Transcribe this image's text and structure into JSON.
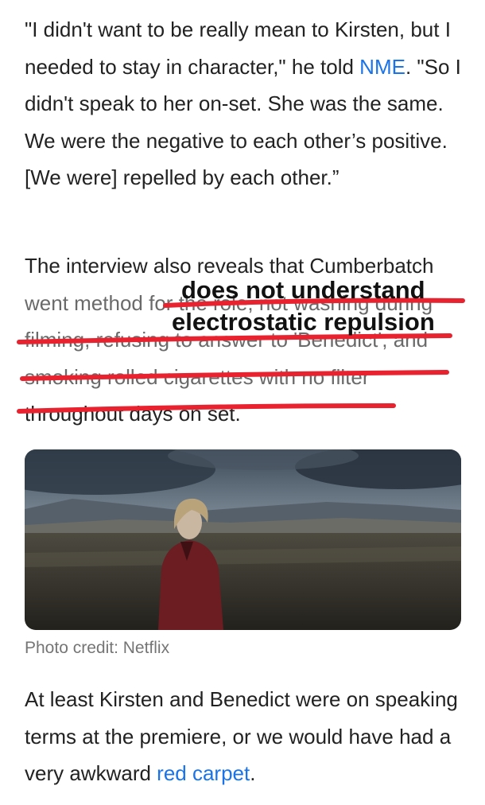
{
  "article": {
    "quote_para": {
      "before_link": "\"I didn't want to be really mean to Kirsten, but I needed to stay in character,\" he told ",
      "link": "NME",
      "after_link": ". \"So I didn't speak to her on-set. She was the same. We were the negative to each other’s positive. [We were] repelled by each other.”"
    },
    "interview_para": {
      "start": "The interview also reveals that Cumberbatch ",
      "struck": "went method for the role, not washing during filming, refusing to answer to 'Benedict', and smoking rolled cigarettes with no filter",
      "end": " throughout days on set."
    },
    "photo_credit": "Photo credit: Netflix",
    "closing_para": {
      "before_link": "At least Kirsten and Benedict were on speaking terms at the premiere, or we would have had a very awkward ",
      "link": "red carpet",
      "after_link": "."
    }
  },
  "annotation": {
    "line1": "does not understand",
    "line2": "electrostatic repulsion"
  },
  "colors": {
    "link": "#1a73e8",
    "annotation_ink": "#e8232f",
    "body_text": "#222222"
  }
}
